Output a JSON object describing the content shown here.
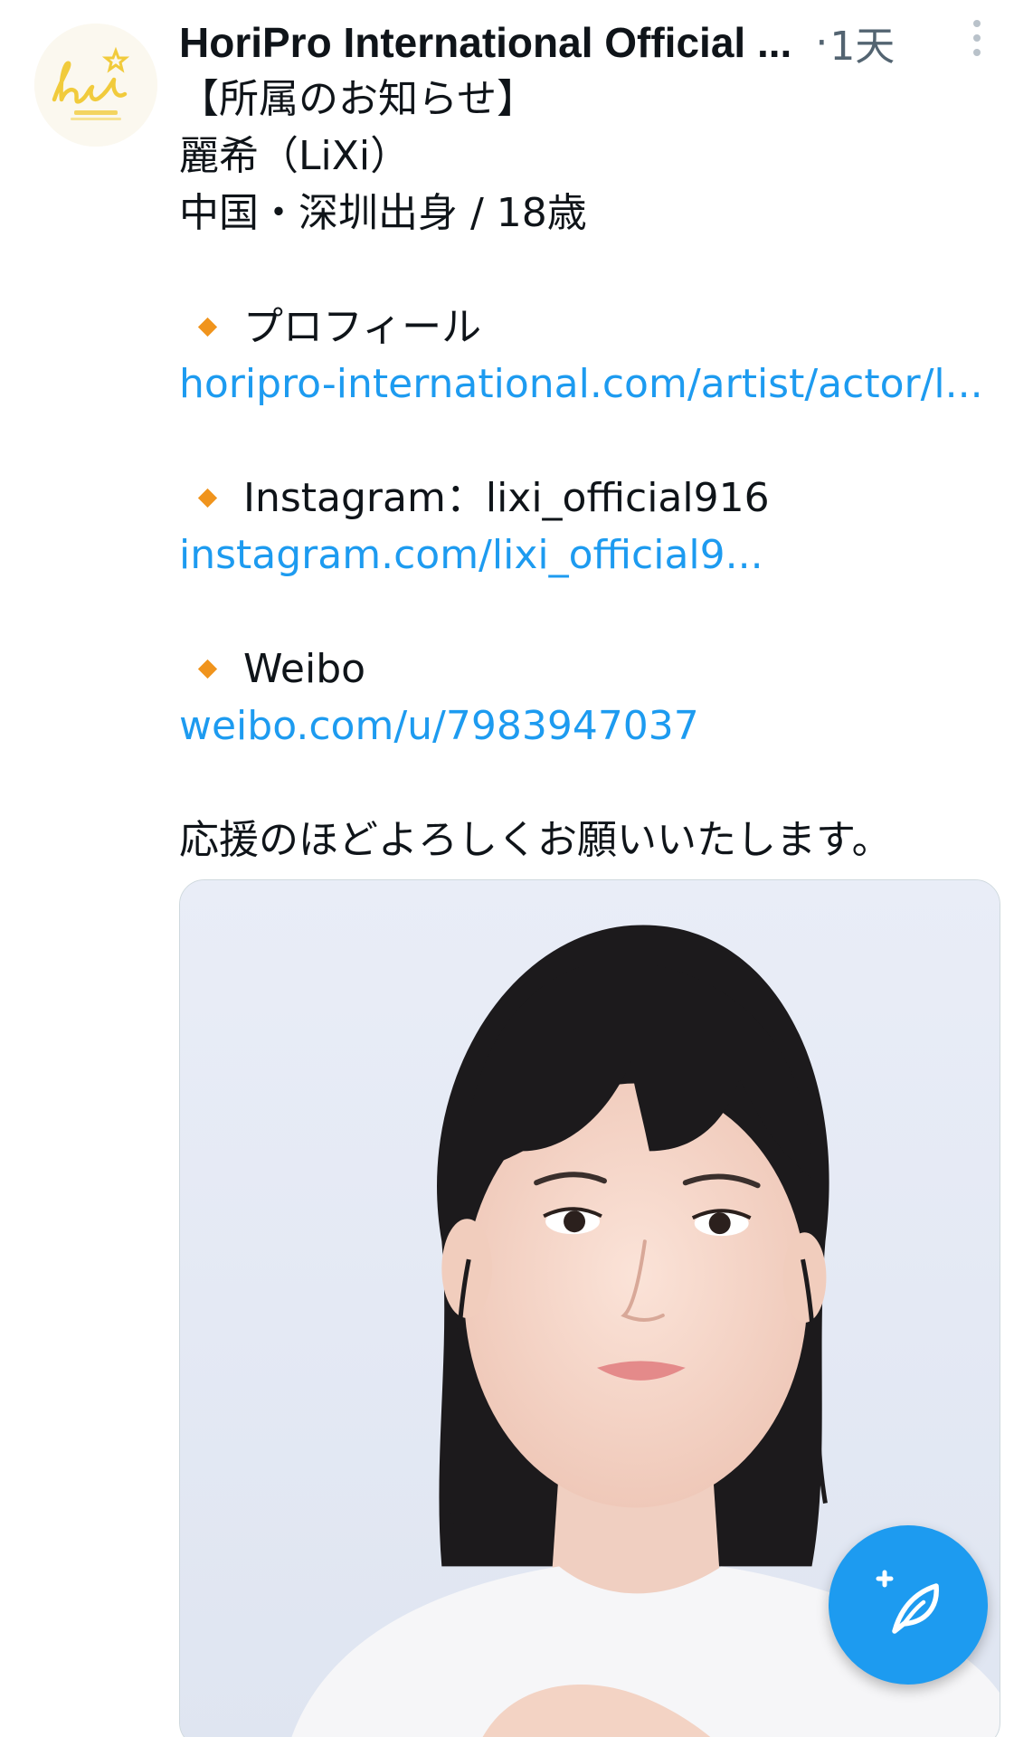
{
  "tweet": {
    "author_name": "HoriPro International Official ...",
    "separator": "·",
    "time_ago": "1天",
    "avatar_icon": "horipro-logo",
    "more_icon": "more-vertical-icon",
    "lines": {
      "headline": "【所属のお知らせ】",
      "name": "麗希（LiXi）",
      "origin": "中国・深圳出身 / 18歳",
      "profile_label": "プロフィール",
      "profile_link": "horipro-international.com/artist/actor/l...",
      "instagram_label": "Instagram：lixi_official916",
      "instagram_link": "instagram.com/lixi_official9...",
      "weibo_label": "Weibo",
      "weibo_link": "weibo.com/u/7983947037",
      "closing": "応援のほどよろしくお願いいたします。"
    },
    "bullet_icon": "orange-diamond-icon",
    "media_alt": "portrait photo"
  },
  "fab": {
    "icon": "compose-feather-icon"
  },
  "colors": {
    "link": "#1d9bf0",
    "text": "#0f1419",
    "muted": "#536471",
    "bullet": "#f0941d",
    "fab": "#1d9bf0"
  }
}
